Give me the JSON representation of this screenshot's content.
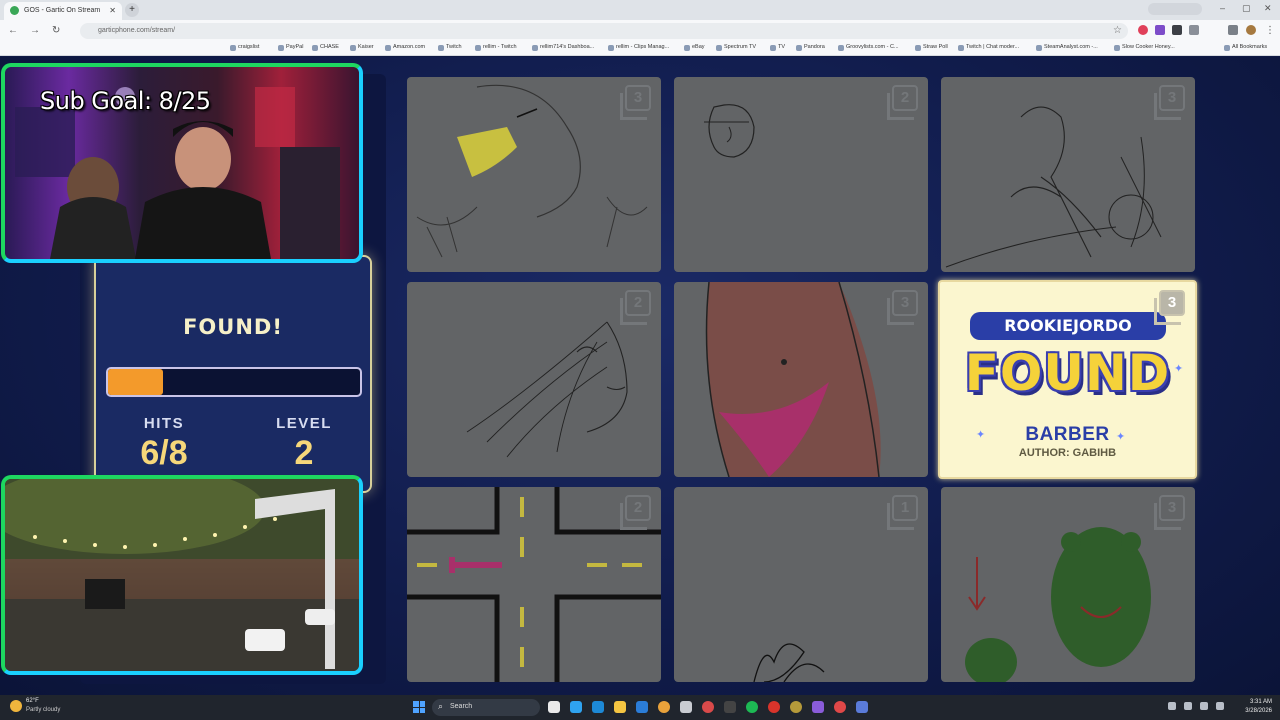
{
  "browser": {
    "tab_title": "GOS - Gartic On Stream",
    "url": "garticphone.com/stream/",
    "bookmarks": [
      "craigslist",
      "PayPal",
      "CHASE",
      "Kaiser",
      "Amazon.com",
      "Twitch",
      "rellim - Twitch",
      "rellim714's Dashboa...",
      "rellim - Clips Manag...",
      "eBay",
      "Spectrum TV",
      "TV",
      "Pandora",
      "Groovylists.com - C...",
      "Straw Poll",
      "Twitch | Chat moder...",
      "SteamAnalyst.com -...",
      "Slow Cooker Honey..."
    ],
    "all_bookmarks": "All Bookmarks"
  },
  "overlay": {
    "sub_goal": "Sub Goal: 8/25"
  },
  "score": {
    "status": "FOUND!",
    "progress_fraction": 0.22,
    "hits_label": "HITS",
    "hits_value": "6/8",
    "level_label": "LEVEL",
    "level_value": "2"
  },
  "grid": {
    "cards": [
      {
        "number": "3",
        "drawing": "eagle"
      },
      {
        "number": "2",
        "drawing": "face-sketch"
      },
      {
        "number": "3",
        "drawing": "cyclist"
      },
      {
        "number": "2",
        "drawing": "woman-face"
      },
      {
        "number": "3",
        "drawing": "torso"
      },
      {
        "number": "3",
        "state": "found"
      },
      {
        "number": "2",
        "drawing": "crossroads"
      },
      {
        "number": "1",
        "drawing": "scribble"
      },
      {
        "number": "3",
        "drawing": "frogs"
      }
    ],
    "found_card": {
      "player": "ROOKIEJORDO",
      "label": "FOUND",
      "answer": "BARBER",
      "author": "AUTHOR: GABIHB"
    }
  },
  "taskbar": {
    "weather_temp": "62°F",
    "weather_desc": "Partly cloudy",
    "search_placeholder": "Search",
    "time": "3:31 AM",
    "date": "3/28/2026"
  },
  "colors": {
    "accent_orange": "#f39a2b",
    "found_yellow": "#f5d23a",
    "player_blue": "#2a3ea7",
    "webcam_green": "#1ed760",
    "webcam_cyan": "#1ad0ff"
  }
}
